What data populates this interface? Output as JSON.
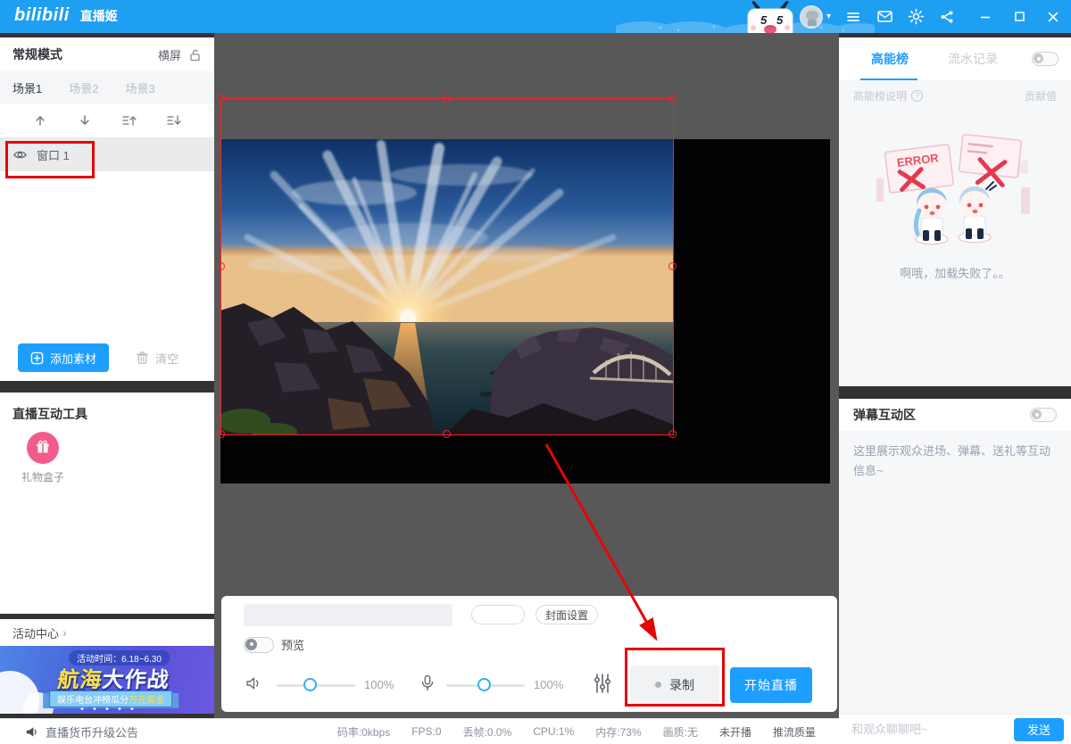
{
  "colors": {
    "accent": "#1e9fff",
    "topbar": "#1e9ff2",
    "annotation": "#e60505",
    "gift_pink": "#f25c8a"
  },
  "icons": {
    "caret_down": "▾",
    "chevron_right": "›"
  },
  "app": {
    "brand": "bilibili",
    "title": "直播姬"
  },
  "left": {
    "mode": "常规模式",
    "orientation": "横屏",
    "scenes": [
      "场景1",
      "场景2",
      "场景3"
    ],
    "source": "窗口 1",
    "add": "添加素材",
    "clear": "清空",
    "tools_title": "直播互动工具",
    "gift": "礼物盒子",
    "activity_title": "活动中心",
    "banner": {
      "time": "活动时间：6.18~6.30",
      "title_em": "航海",
      "title_rest": "大作战",
      "ribbon_white": "娱乐电台冲榜瓜分",
      "ribbon_yellow": "万元奖金"
    }
  },
  "controls": {
    "cover": "封面设置",
    "preview": "预览",
    "vol_speaker": "100%",
    "vol_mic": "100%",
    "record": "录制",
    "start": "开始直播"
  },
  "status": {
    "announcement": "直播货币升级公告",
    "stats": [
      "码率:0kbps",
      "FPS:0",
      "丢帧:0.0%",
      "CPU:1%",
      "内存:73%",
      "画质:无",
      "未开播",
      "推流质量"
    ]
  },
  "right": {
    "tab_rank": "高能榜",
    "tab_flow": "流水记录",
    "rank_help": "高能榜说明",
    "help_q": "?",
    "contribution": "贡献值",
    "error_sign": "ERROR",
    "load_fail": "啊哦，加载失败了。。",
    "danmu_title": "弹幕互动区",
    "danmu_hint": "这里展示观众进场、弹幕、送礼等互动信息~",
    "chat_placeholder": "和观众聊聊吧~",
    "send": "发送"
  }
}
